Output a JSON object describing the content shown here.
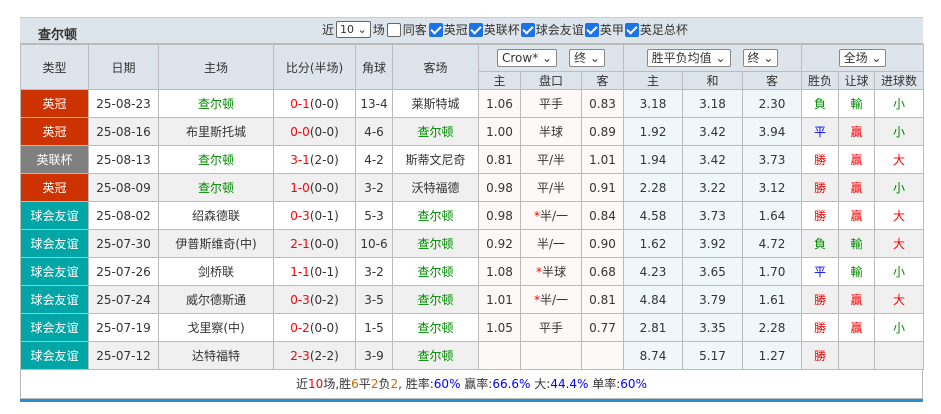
{
  "team": "查尔顿",
  "filters": {
    "recent_label": "近",
    "recent_value": "10",
    "matches_label": "场",
    "same_home_label": "同客",
    "same_home_checked": false,
    "competitions": [
      {
        "label": "英冠",
        "checked": true
      },
      {
        "label": "英联杯",
        "checked": true
      },
      {
        "label": "球会友谊",
        "checked": true
      },
      {
        "label": "英甲",
        "checked": true
      },
      {
        "label": "英足总杯",
        "checked": true
      }
    ]
  },
  "headers": {
    "type": "类型",
    "date": "日期",
    "home": "主场",
    "score": "比分(半场)",
    "corners": "角球",
    "away": "客场",
    "handicap_company": "Crow*",
    "handicap_time": "终",
    "odds_type": "胜平负均值",
    "odds_time": "终",
    "period": "全场",
    "h_home": "主",
    "h_line": "盘口",
    "h_away": "客",
    "o_home": "主",
    "o_draw": "和",
    "o_away": "客",
    "result": "胜负",
    "handicap_result": "让球",
    "goals": "进球数"
  },
  "colors": {
    "英冠": "#cc3300",
    "英联杯": "#808080",
    "球会友谊": "#00a6a6",
    "win": "#ff0000",
    "draw": "#0000ff",
    "loss": "#008800"
  },
  "rows": [
    {
      "type": "英冠",
      "date": "25-08-23",
      "home": "查尔顿",
      "score": "0-1",
      "half": "(0-0)",
      "corners": "13-4",
      "away": "莱斯特城",
      "hh": "1.06",
      "hl": "平手",
      "ha": "0.83",
      "oh": "3.18",
      "od": "3.18",
      "oa": "2.30",
      "res": "負",
      "hres": "輸",
      "goals": "小",
      "team_home": true
    },
    {
      "type": "英冠",
      "date": "25-08-16",
      "home": "布里斯托城",
      "score": "0-0",
      "half": "(0-0)",
      "corners": "4-6",
      "away": "查尔顿",
      "hh": "1.00",
      "hl": "半球",
      "ha": "0.89",
      "oh": "1.92",
      "od": "3.42",
      "oa": "3.94",
      "res": "平",
      "hres": "贏",
      "goals": "小",
      "team_home": false
    },
    {
      "type": "英联杯",
      "date": "25-08-13",
      "home": "查尔顿",
      "score": "3-1",
      "half": "(2-0)",
      "corners": "4-2",
      "away": "斯蒂文尼奇",
      "hh": "0.81",
      "hl": "平/半",
      "ha": "1.01",
      "oh": "1.94",
      "od": "3.42",
      "oa": "3.73",
      "res": "勝",
      "hres": "贏",
      "goals": "大",
      "team_home": true
    },
    {
      "type": "英冠",
      "date": "25-08-09",
      "home": "查尔顿",
      "score": "1-0",
      "half": "(0-0)",
      "corners": "3-2",
      "away": "沃特福德",
      "hh": "0.98",
      "hl": "平/半",
      "ha": "0.91",
      "oh": "2.28",
      "od": "3.22",
      "oa": "3.12",
      "res": "勝",
      "hres": "贏",
      "goals": "小",
      "team_home": true
    },
    {
      "type": "球会友谊",
      "date": "25-08-02",
      "home": "绍森德联",
      "score": "0-3",
      "half": "(0-1)",
      "corners": "5-3",
      "away": "查尔顿",
      "hh": "0.98",
      "hl_star": "*",
      "hl": "半/一",
      "ha": "0.84",
      "oh": "4.58",
      "od": "3.73",
      "oa": "1.64",
      "res": "勝",
      "hres": "贏",
      "goals": "大",
      "team_home": false
    },
    {
      "type": "球会友谊",
      "date": "25-07-30",
      "home": "伊普斯维奇(中)",
      "score": "2-1",
      "half": "(0-0)",
      "corners": "10-6",
      "away": "查尔顿",
      "hh": "0.92",
      "hl": "半/一",
      "ha": "0.90",
      "oh": "1.62",
      "od": "3.92",
      "oa": "4.72",
      "res": "負",
      "hres": "輸",
      "goals": "大",
      "team_home": false
    },
    {
      "type": "球会友谊",
      "date": "25-07-26",
      "home": "剑桥联",
      "score": "1-1",
      "half": "(0-1)",
      "corners": "3-2",
      "away": "查尔顿",
      "hh": "1.08",
      "hl_star": "*",
      "hl": "半球",
      "ha": "0.68",
      "oh": "4.23",
      "od": "3.65",
      "oa": "1.70",
      "res": "平",
      "hres": "輸",
      "goals": "小",
      "team_home": false
    },
    {
      "type": "球会友谊",
      "date": "25-07-24",
      "home": "威尔德斯通",
      "score": "0-3",
      "half": "(0-2)",
      "corners": "3-5",
      "away": "查尔顿",
      "hh": "1.01",
      "hl_star": "*",
      "hl": "半/一",
      "ha": "0.81",
      "oh": "4.84",
      "od": "3.79",
      "oa": "1.61",
      "res": "勝",
      "hres": "贏",
      "goals": "大",
      "team_home": false
    },
    {
      "type": "球会友谊",
      "date": "25-07-19",
      "home": "戈里察(中)",
      "score": "0-2",
      "half": "(0-0)",
      "corners": "1-5",
      "away": "查尔顿",
      "hh": "1.05",
      "hl": "平手",
      "ha": "0.77",
      "oh": "2.81",
      "od": "3.35",
      "oa": "2.28",
      "res": "勝",
      "hres": "贏",
      "goals": "小",
      "team_home": false
    },
    {
      "type": "球会友谊",
      "date": "25-07-12",
      "home": "达特福特",
      "score": "2-3",
      "half": "(2-2)",
      "corners": "3-9",
      "away": "查尔顿",
      "hh": "",
      "hl": "",
      "ha": "",
      "oh": "8.74",
      "od": "5.17",
      "oa": "1.27",
      "res": "勝",
      "hres": "",
      "goals": "",
      "team_home": false
    }
  ],
  "summary": {
    "p1": "近",
    "n": "10",
    "p2": "场,胜",
    "w": "6",
    "p3": "平",
    "d": "2",
    "p4": "负",
    "l": "2",
    "p5": ", 胜率:",
    "wr": "60%",
    "p6": " 赢率:",
    "hr": "66.6%",
    "p7": " 大:",
    "br": "44.4%",
    "p8": " 单率:",
    "or": "60%"
  }
}
